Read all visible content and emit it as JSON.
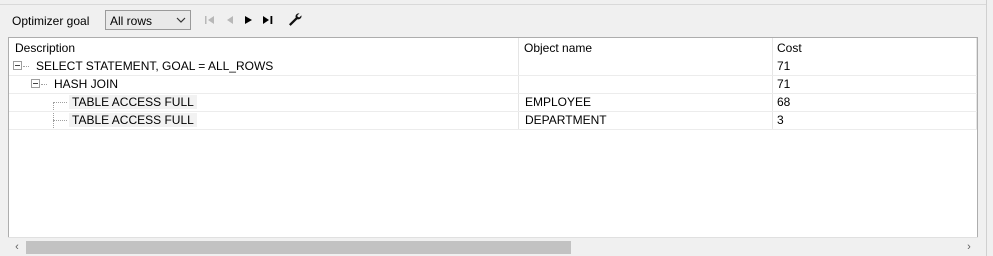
{
  "toolbar": {
    "label": "Optimizer goal",
    "goal_value": "All rows",
    "icons": [
      "first-icon",
      "previous-icon",
      "next-icon",
      "last-icon",
      "wrench-icon"
    ]
  },
  "columns": {
    "description": "Description",
    "object_name": "Object name",
    "cost": "Cost"
  },
  "rows": [
    {
      "description": "SELECT STATEMENT, GOAL = ALL_ROWS",
      "object_name": "",
      "cost": "71"
    },
    {
      "description": "HASH JOIN",
      "object_name": "",
      "cost": "71"
    },
    {
      "description": "TABLE ACCESS FULL",
      "object_name": "EMPLOYEE",
      "cost": "68"
    },
    {
      "description": "TABLE ACCESS FULL",
      "object_name": "DEPARTMENT",
      "cost": "3"
    }
  ],
  "colors": {
    "selection": "#f2f2f2",
    "border": "#adadad",
    "background": "#f0f0f0"
  }
}
